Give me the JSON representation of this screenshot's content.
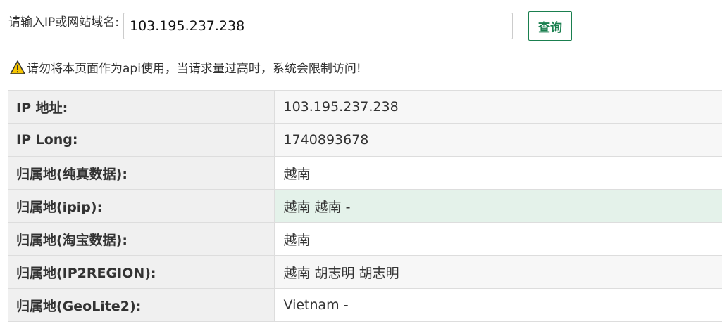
{
  "search": {
    "label": "请输入IP或网站域名:",
    "value": "103.195.237.238",
    "button_label": "查询"
  },
  "warning": {
    "icon": "warning-triangle-icon",
    "text": "请勿将本页面作为api使用，当请求量过高时，系统会限制访问!"
  },
  "rows": [
    {
      "key": "IP 地址:",
      "value": "103.195.237.238"
    },
    {
      "key": "IP Long:",
      "value": "1740893678"
    },
    {
      "key": "归属地(纯真数据):",
      "value": "越南"
    },
    {
      "key": "归属地(ipip):",
      "value": "越南 越南 -"
    },
    {
      "key": "归属地(淘宝数据):",
      "value": "越南"
    },
    {
      "key": "归属地(IP2REGION):",
      "value": "越南 胡志明 胡志明"
    },
    {
      "key": "归属地(GeoLite2):",
      "value": "Vietnam -"
    }
  ],
  "colors": {
    "accent": "#1a7f4f",
    "row_highlight": "#e4f2ea",
    "key_bg": "#f0f0f0",
    "warning_icon": "#f5c400"
  }
}
